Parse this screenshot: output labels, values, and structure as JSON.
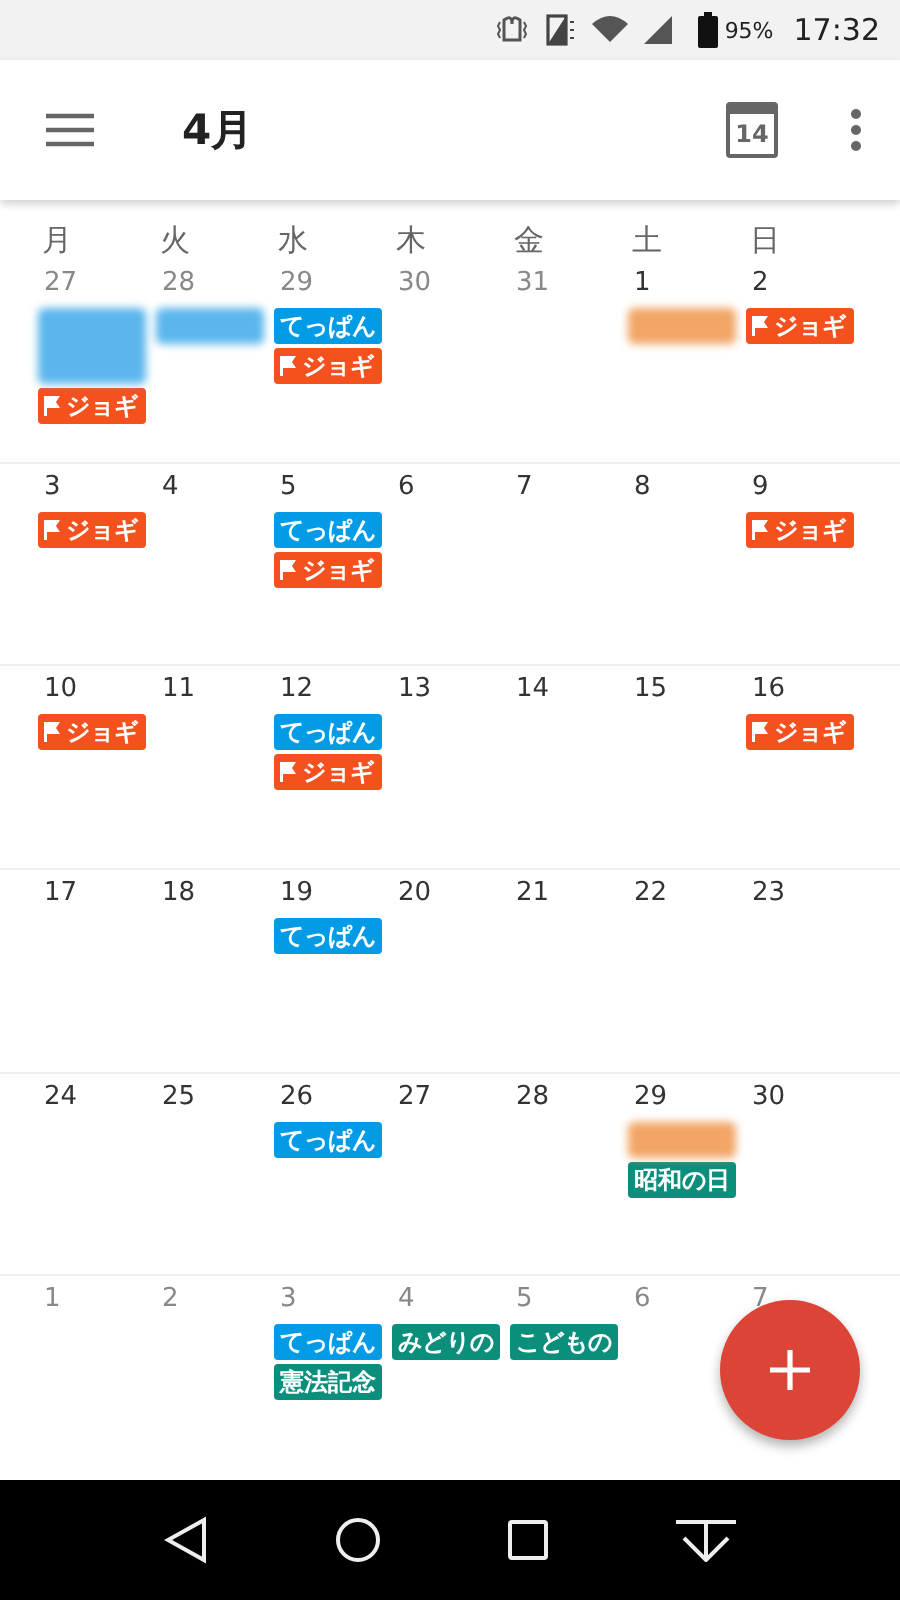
{
  "status_bar": {
    "battery": "95%",
    "time": "17:32"
  },
  "app_bar": {
    "title": "4月",
    "today_day": "14"
  },
  "weekdays": [
    "月",
    "火",
    "水",
    "木",
    "金",
    "土",
    "日"
  ],
  "weeks": [
    {
      "days": [
        {
          "date": "27",
          "muted": true,
          "events": [
            {
              "kind": "blurred-tall",
              "color": "#5ab6ec"
            },
            {
              "kind": "event",
              "label": "ジョギ",
              "flag": true,
              "color": "#f4511e"
            }
          ]
        },
        {
          "date": "28",
          "muted": true,
          "events": [
            {
              "kind": "blurred",
              "color": "#5ab6ec"
            }
          ]
        },
        {
          "date": "29",
          "muted": true,
          "events": [
            {
              "kind": "event",
              "label": "てっぱん",
              "flag": false,
              "color": "#039be5"
            },
            {
              "kind": "event",
              "label": "ジョギ",
              "flag": true,
              "color": "#f4511e"
            }
          ]
        },
        {
          "date": "30",
          "muted": true
        },
        {
          "date": "31",
          "muted": true
        },
        {
          "date": "1",
          "muted": false,
          "events": [
            {
              "kind": "blurred",
              "color": "#f2a566"
            }
          ]
        },
        {
          "date": "2",
          "muted": false,
          "events": [
            {
              "kind": "event",
              "label": "ジョギ",
              "flag": true,
              "color": "#f4511e"
            }
          ]
        }
      ]
    },
    {
      "days": [
        {
          "date": "3",
          "muted": false,
          "events": [
            {
              "kind": "event",
              "label": "ジョギ",
              "flag": true,
              "color": "#f4511e"
            }
          ]
        },
        {
          "date": "4",
          "muted": false
        },
        {
          "date": "5",
          "muted": false,
          "events": [
            {
              "kind": "event",
              "label": "てっぱん",
              "flag": false,
              "color": "#039be5"
            },
            {
              "kind": "event",
              "label": "ジョギ",
              "flag": true,
              "color": "#f4511e"
            }
          ]
        },
        {
          "date": "6",
          "muted": false
        },
        {
          "date": "7",
          "muted": false
        },
        {
          "date": "8",
          "muted": false
        },
        {
          "date": "9",
          "muted": false,
          "events": [
            {
              "kind": "event",
              "label": "ジョギ",
              "flag": true,
              "color": "#f4511e"
            }
          ]
        }
      ]
    },
    {
      "days": [
        {
          "date": "10",
          "muted": false,
          "events": [
            {
              "kind": "event",
              "label": "ジョギ",
              "flag": true,
              "color": "#f4511e"
            }
          ]
        },
        {
          "date": "11",
          "muted": false
        },
        {
          "date": "12",
          "muted": false,
          "events": [
            {
              "kind": "event",
              "label": "てっぱん",
              "flag": false,
              "color": "#039be5"
            },
            {
              "kind": "event",
              "label": "ジョギ",
              "flag": true,
              "color": "#f4511e"
            }
          ]
        },
        {
          "date": "13",
          "muted": false
        },
        {
          "date": "14",
          "muted": false
        },
        {
          "date": "15",
          "muted": false
        },
        {
          "date": "16",
          "muted": false,
          "events": [
            {
              "kind": "event",
              "label": "ジョギ",
              "flag": true,
              "color": "#f4511e"
            }
          ]
        }
      ]
    },
    {
      "days": [
        {
          "date": "17",
          "muted": false
        },
        {
          "date": "18",
          "muted": false
        },
        {
          "date": "19",
          "muted": false,
          "events": [
            {
              "kind": "event",
              "label": "てっぱん",
              "flag": false,
              "color": "#039be5"
            }
          ]
        },
        {
          "date": "20",
          "muted": false
        },
        {
          "date": "21",
          "muted": false
        },
        {
          "date": "22",
          "muted": false
        },
        {
          "date": "23",
          "muted": false
        }
      ]
    },
    {
      "days": [
        {
          "date": "24",
          "muted": false
        },
        {
          "date": "25",
          "muted": false
        },
        {
          "date": "26",
          "muted": false,
          "events": [
            {
              "kind": "event",
              "label": "てっぱん",
              "flag": false,
              "color": "#039be5"
            }
          ]
        },
        {
          "date": "27",
          "muted": false
        },
        {
          "date": "28",
          "muted": false
        },
        {
          "date": "29",
          "muted": false,
          "events": [
            {
              "kind": "blurred",
              "color": "#f2a566"
            },
            {
              "kind": "event",
              "label": "昭和の日",
              "flag": false,
              "color": "#0b8f7c"
            }
          ]
        },
        {
          "date": "30",
          "muted": false
        }
      ]
    },
    {
      "days": [
        {
          "date": "1",
          "muted": true
        },
        {
          "date": "2",
          "muted": true
        },
        {
          "date": "3",
          "muted": true,
          "events": [
            {
              "kind": "event",
              "label": "てっぱん",
              "flag": false,
              "color": "#039be5"
            },
            {
              "kind": "event",
              "label": "憲法記念",
              "flag": false,
              "color": "#0b8f7c"
            }
          ]
        },
        {
          "date": "4",
          "muted": true,
          "events": [
            {
              "kind": "event",
              "label": "みどりの",
              "flag": false,
              "color": "#0b8f7c"
            }
          ]
        },
        {
          "date": "5",
          "muted": true,
          "events": [
            {
              "kind": "event",
              "label": "こどもの",
              "flag": false,
              "color": "#0b8f7c"
            }
          ]
        },
        {
          "date": "6",
          "muted": true
        },
        {
          "date": "7",
          "muted": true
        }
      ]
    }
  ]
}
